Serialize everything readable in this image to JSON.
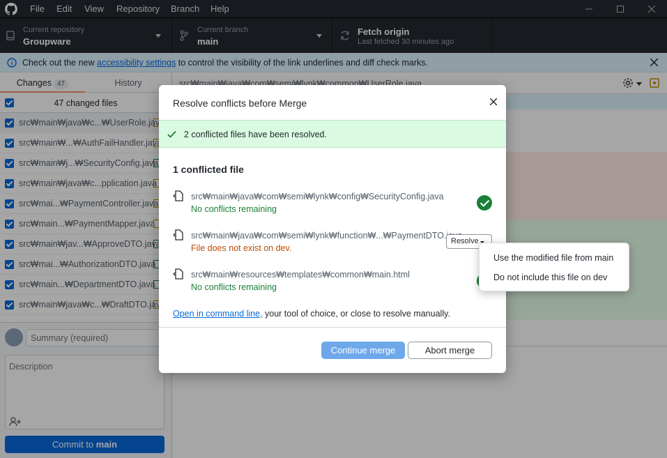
{
  "menu": [
    "File",
    "Edit",
    "View",
    "Repository",
    "Branch",
    "Help"
  ],
  "toolbar": {
    "repo_label": "Current repository",
    "repo_value": "Groupware",
    "branch_label": "Current branch",
    "branch_value": "main",
    "fetch_label": "Fetch origin",
    "fetch_sub": "Last fetched 30 minutes ago"
  },
  "banner": {
    "text_before": "Check out the new ",
    "link": "accessibility settings",
    "text_after": " to control the visibility of the link underlines and diff check marks."
  },
  "sidebar": {
    "tab_changes": "Changes",
    "changes_count": "47",
    "tab_history": "History",
    "changed_files_label": "47 changed files",
    "files": [
      "src₩main₩java₩c...₩UserRole.java",
      "src₩main₩...₩AuthFailHandler.java",
      "src₩main₩j...₩SecurityConfig.java",
      "src₩main₩java₩c...pplication.java",
      "src₩mai...₩PaymentController.java",
      "src₩main...₩PaymentMapper.java",
      "src₩main₩jav...₩ApproveDTO.java",
      "src₩mai...₩AuthorizationDTO.java",
      "src₩main...₩DepartmentDTO.java",
      "src₩main₩java₩c...₩DraftDTO.java"
    ],
    "summary_placeholder": "Summary (required)",
    "description_placeholder": "Description",
    "commit_prefix": "Commit to ",
    "commit_branch": "main"
  },
  "main": {
    "file_path": "src₩main₩java₩com₩semi₩lynk₩common₩UserRole.java"
  },
  "dialog": {
    "title": "Resolve conflicts before Merge",
    "success": "2 conflicted files have been resolved.",
    "heading": "1 conflicted file",
    "files": [
      {
        "path": "src₩main₩java₩com₩semi₩lynk₩config₩SecurityConfig.java",
        "status": "No conflicts remaining"
      },
      {
        "path": "src₩main₩java₩com₩semi₩lynk₩function₩...₩PaymentDTO.java",
        "status": "File does not exist on dev."
      },
      {
        "path": "src₩main₩resources₩templates₩common₩main.html",
        "status": "No conflicts remaining"
      }
    ],
    "resolve_label": "Resolve",
    "footer_link": "Open in command line,",
    "footer_text": " your tool of choice, or close to resolve manually.",
    "continue_label": "Continue merge",
    "abort_label": "Abort merge"
  },
  "popup": {
    "options": [
      "Use the modified file from main",
      "Do not include this file on dev"
    ]
  },
  "colors": {
    "accent": "#0969da",
    "success_bg": "#dafbe1",
    "success": "#1a7f37",
    "error": "#bc4c00",
    "titlebar": "#24292e"
  }
}
